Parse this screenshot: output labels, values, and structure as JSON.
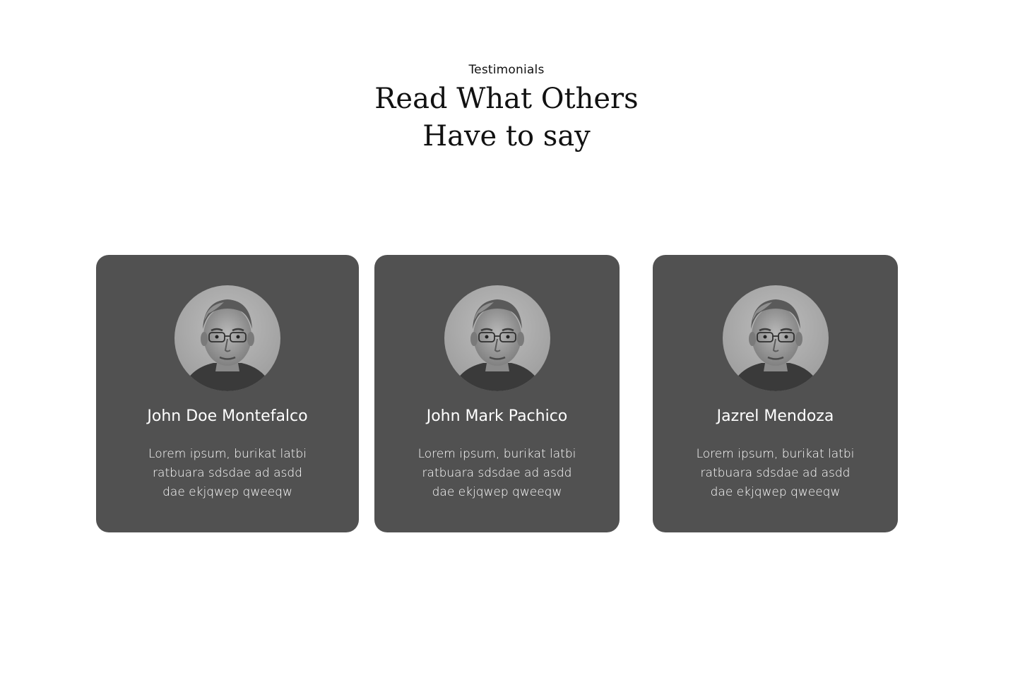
{
  "header": {
    "eyebrow": "Testimonials",
    "title_line_1": "Read What Others",
    "title_line_2": "Have to say"
  },
  "colors": {
    "card_background": "#515151",
    "card_text": "#ffffff",
    "page_background": "#ffffff",
    "heading_text": "#111111"
  },
  "testimonials": [
    {
      "name": "John Doe Montefalco",
      "quote_lines": [
        "Lorem ipsum, burikat latbi",
        "ratbuara sdsdae ad asdd",
        "dae ekjqwep qweeqw"
      ],
      "avatar_icon": "person-portrait"
    },
    {
      "name": "John Mark Pachico",
      "quote_lines": [
        "Lorem ipsum, burikat latbi",
        "ratbuara sdsdae ad asdd",
        "dae ekjqwep qweeqw"
      ],
      "avatar_icon": "person-portrait"
    },
    {
      "name": "Jazrel Mendoza",
      "quote_lines": [
        "Lorem ipsum, burikat latbi",
        "ratbuara sdsdae ad asdd",
        "dae ekjqwep qweeqw"
      ],
      "avatar_icon": "person-portrait"
    }
  ]
}
